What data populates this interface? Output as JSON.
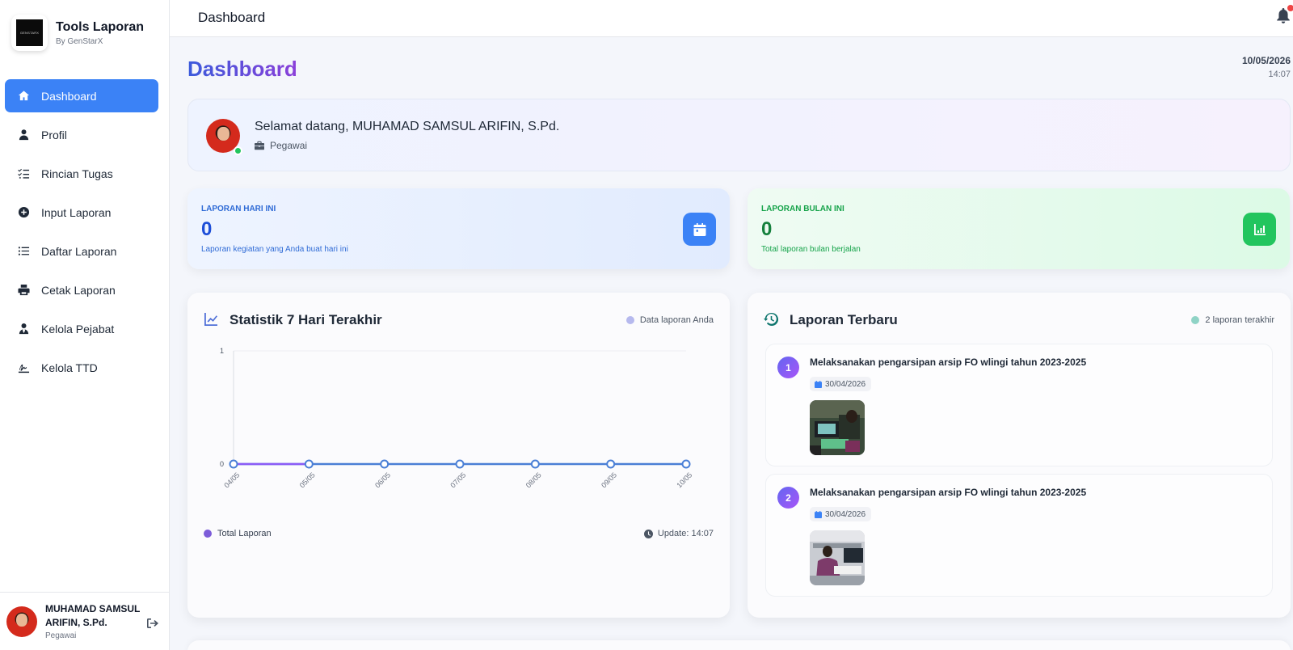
{
  "brand": {
    "title": "Tools Laporan",
    "subtitle": "By GenStarX",
    "logo_text": "GENSTARX"
  },
  "sidebar": {
    "items": [
      {
        "label": "Dashboard",
        "icon": "home-icon",
        "active": true
      },
      {
        "label": "Profil",
        "icon": "user-icon"
      },
      {
        "label": "Rincian Tugas",
        "icon": "tasks-icon"
      },
      {
        "label": "Input Laporan",
        "icon": "plus-circle-icon"
      },
      {
        "label": "Daftar Laporan",
        "icon": "list-icon"
      },
      {
        "label": "Cetak Laporan",
        "icon": "print-icon"
      },
      {
        "label": "Kelola Pejabat",
        "icon": "user-tie-icon"
      },
      {
        "label": "Kelola TTD",
        "icon": "signature-icon"
      }
    ],
    "user": {
      "name": "MUHAMAD SAMSUL ARIFIN, S.Pd.",
      "role": "Pegawai"
    }
  },
  "topbar": {
    "title": "Dashboard"
  },
  "main": {
    "page_title": "Dashboard",
    "date": "10/05/2026",
    "time": "14:07",
    "welcome": {
      "text": "Selamat datang, MUHAMAD SAMSUL ARIFIN, S.Pd.",
      "role": "Pegawai"
    },
    "stats": {
      "today": {
        "label": "LAPORAN HARI INI",
        "value": "0",
        "desc": "Laporan kegiatan yang Anda buat hari ini"
      },
      "month": {
        "label": "LAPORAN BULAN INI",
        "value": "0",
        "desc": "Total laporan bulan berjalan"
      }
    },
    "chart_panel": {
      "title": "Statistik 7 Hari Terakhir",
      "legend_top": "Data laporan Anda",
      "legend_bottom": "Total Laporan",
      "update": "Update: 14:07"
    },
    "recent_panel": {
      "title": "Laporan Terbaru",
      "count_label": "2 laporan terakhir",
      "items": [
        {
          "num": "1",
          "title": "Melaksanakan pengarsipan arsip FO wlingi tahun 2023-2025",
          "date": "30/04/2026"
        },
        {
          "num": "2",
          "title": "Melaksanakan pengarsipan arsip FO wlingi tahun 2023-2025",
          "date": "30/04/2026"
        }
      ]
    }
  },
  "colors": {
    "accent": "#3b82f6",
    "success": "#22c55e",
    "line": "#4a7fd6"
  },
  "chart_data": {
    "type": "line",
    "categories": [
      "04/05",
      "05/05",
      "06/05",
      "07/05",
      "08/05",
      "09/05",
      "10/05"
    ],
    "series": [
      {
        "name": "Total Laporan",
        "values": [
          0,
          0,
          0,
          0,
          0,
          0,
          0
        ]
      }
    ],
    "ylim": [
      0,
      1
    ],
    "yticks": [
      "0",
      "1"
    ],
    "grid": true,
    "legend": "bottom-left"
  }
}
